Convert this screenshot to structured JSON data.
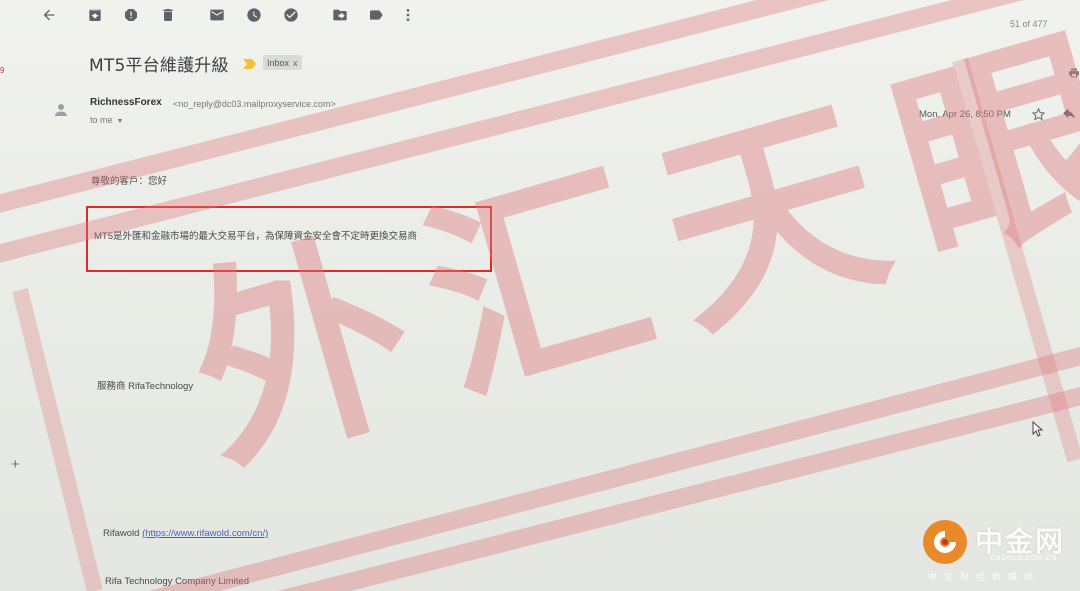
{
  "toolbar": {
    "icons": [
      "back-arrow-icon",
      "archive-icon",
      "report-spam-icon",
      "delete-icon",
      "mark-unread-icon",
      "snooze-icon",
      "add-task-icon",
      "move-to-icon",
      "label-icon",
      "more-icon"
    ],
    "pager": "51 of 477"
  },
  "left_badge": "9",
  "message": {
    "subject": "MT5平台維護升級",
    "label": "Inbox",
    "label_remove": "x",
    "sender_name": "RichnessForex",
    "sender_email": "<no_reply@dc03.mailproxyservice.com>",
    "to": "to me",
    "date": "Mon, Apr 26, 8:50 PM"
  },
  "body": {
    "greeting": "尊敬的客戶：您好",
    "main": "MT5是外匯和金融市場的最大交易平台，為保障資金安全會不定時更換交易商",
    "signature": "服務商 RifaTechnology",
    "site_label": "Rifawold",
    "site_url": "(https://www.rifawold.com/cn/)",
    "company": "Rifa Technology Company Limited"
  },
  "overlay": {
    "stamp_text": "外汇天眼",
    "stamp_color": "#de787d",
    "highlight_color": "#e02a2a"
  },
  "watermark": {
    "name": "中金网",
    "domain": "CNGOLD.COM.CN",
    "tagline": "中文财经新媒体",
    "logo_color": "#e98a2a"
  }
}
